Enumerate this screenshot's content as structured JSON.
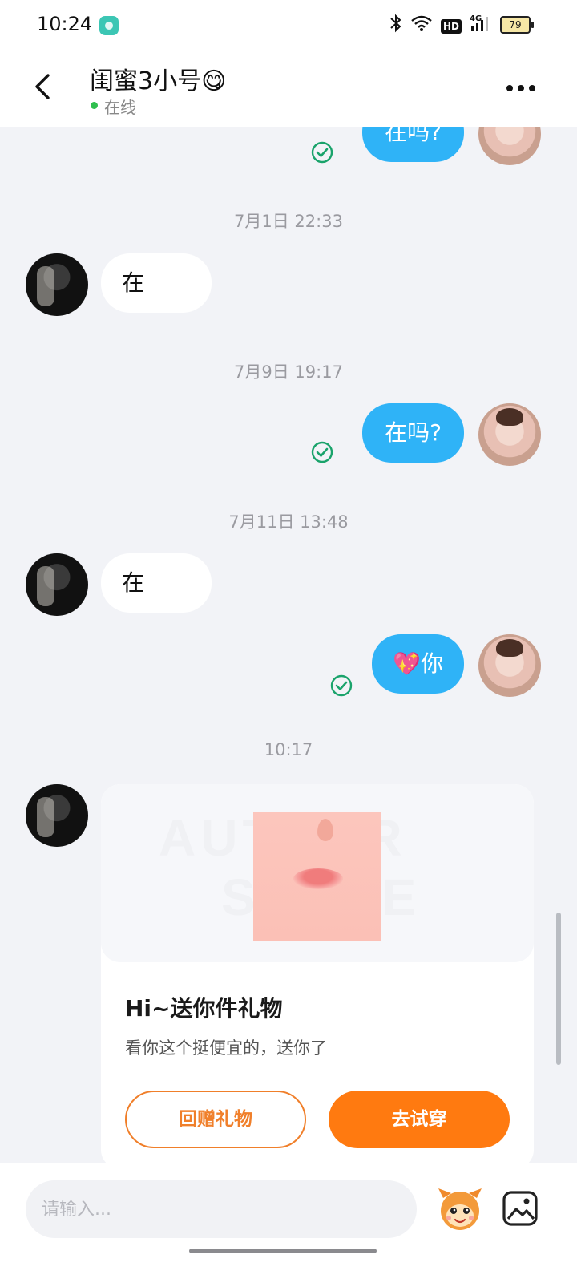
{
  "status_bar": {
    "time": "10:24",
    "hd_label": "HD",
    "network_label": "4G",
    "battery_level": "79"
  },
  "header": {
    "title": "闺蜜3小号😋",
    "status_text": "在线",
    "online_color": "#2fbf4f"
  },
  "messages": {
    "m0_text": "在吗?",
    "t1": "7月1日 22:33",
    "m1_text": "在",
    "t2": "7月9日 19:17",
    "m2_text": "在吗?",
    "t3": "7月11日 13:48",
    "m3_text": "在",
    "m4_text": "💖你",
    "t4": "10:17"
  },
  "gift_card": {
    "banner_word_1": "AUTHOR",
    "banner_word_2": "STORE",
    "title": "Hi~送你件礼物",
    "description": "看你这个挺便宜的，送你了",
    "return_gift_label": "回赠礼物",
    "try_on_label": "去试穿"
  },
  "input_bar": {
    "placeholder": "请输入..."
  },
  "colors": {
    "bubble_right": "#2fb3f7",
    "bubble_left": "#ffffff",
    "accent_orange": "#ff7a10",
    "check_green": "#1aa36b",
    "background": "#f2f3f7"
  },
  "icons": {
    "back": "chevron-left-icon",
    "more": "more-dots-icon",
    "read": "check-circle-icon",
    "mascot": "mascot-icon",
    "image": "image-icon"
  }
}
